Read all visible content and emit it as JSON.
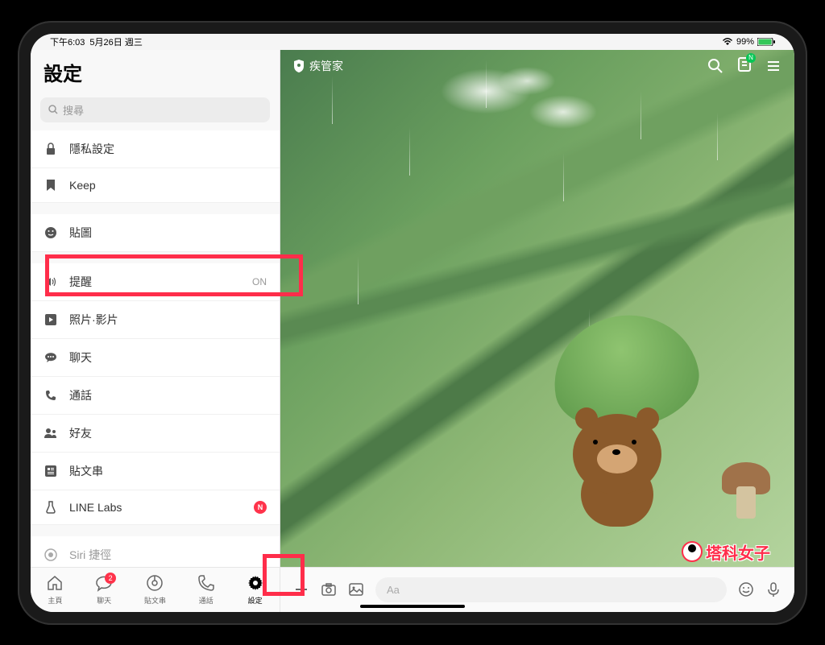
{
  "status": {
    "time": "下午6:03",
    "date": "5月26日 週三",
    "battery": "99%"
  },
  "sidebar": {
    "title": "設定",
    "search_placeholder": "搜尋",
    "groups": [
      [
        {
          "icon": "lock",
          "label": "隱私設定"
        },
        {
          "icon": "bookmark",
          "label": "Keep"
        }
      ],
      [
        {
          "icon": "smile",
          "label": "貼圖"
        }
      ],
      [
        {
          "icon": "speaker",
          "label": "提醒",
          "value": "ON",
          "highlighted": true
        },
        {
          "icon": "play",
          "label": "照片·影片"
        },
        {
          "icon": "chat",
          "label": "聊天"
        },
        {
          "icon": "phone",
          "label": "通話"
        },
        {
          "icon": "person",
          "label": "好友"
        },
        {
          "icon": "feed",
          "label": "貼文串"
        },
        {
          "icon": "flask",
          "label": "LINE Labs",
          "badge": "N"
        }
      ],
      [
        {
          "icon": "siri",
          "label": "Siri 捷徑"
        }
      ]
    ]
  },
  "chat": {
    "title": "疾管家",
    "input_placeholder": "Aa"
  },
  "nav": {
    "tabs": [
      {
        "icon": "home",
        "label": "主頁"
      },
      {
        "icon": "chat",
        "label": "聊天",
        "badge": "2"
      },
      {
        "icon": "feed",
        "label": "貼文串"
      },
      {
        "icon": "phone",
        "label": "通話"
      },
      {
        "icon": "gear",
        "label": "設定",
        "active": true,
        "highlighted": true
      }
    ]
  },
  "watermark": "塔科女子"
}
